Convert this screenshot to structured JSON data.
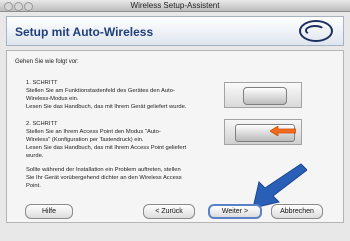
{
  "window": {
    "title": "Wireless Setup-Assistent"
  },
  "banner": {
    "heading": "Setup mit Auto-Wireless"
  },
  "content": {
    "intro": "Gehen Sie wie folgt vor:",
    "step1": {
      "title": "1. SCHRITT",
      "lines": [
        "Stellen Sie am Funktionstastenfeld des Gerätes den Auto-",
        "Wireless-Modus ein.",
        "Lesen Sie das Handbuch, das mit Ihrem Gerät geliefert wurde."
      ]
    },
    "step2": {
      "title": "2. SCHRITT",
      "lines": [
        "Stellen Sie an Ihrem Access Point den Modus \"Auto-",
        "Wireless\" (Konfiguration per Tastendruck) ein.",
        "Lesen Sie das Handbuch, das mit Ihrem Access Point geliefert",
        "wurde."
      ]
    },
    "note": {
      "lines": [
        "Sollte während der Installation ein Problem auftreten, stellen",
        "Sie Ihr Gerät vorübergehend dichter an den Wireless Access",
        "Point."
      ]
    }
  },
  "buttons": {
    "help": "Hilfe",
    "back": "< Zurück",
    "next": "Weiter >",
    "cancel": "Abbrechen"
  },
  "colors": {
    "accent_blue": "#2a5fb8",
    "orange_arrow": "#f26a1b"
  }
}
